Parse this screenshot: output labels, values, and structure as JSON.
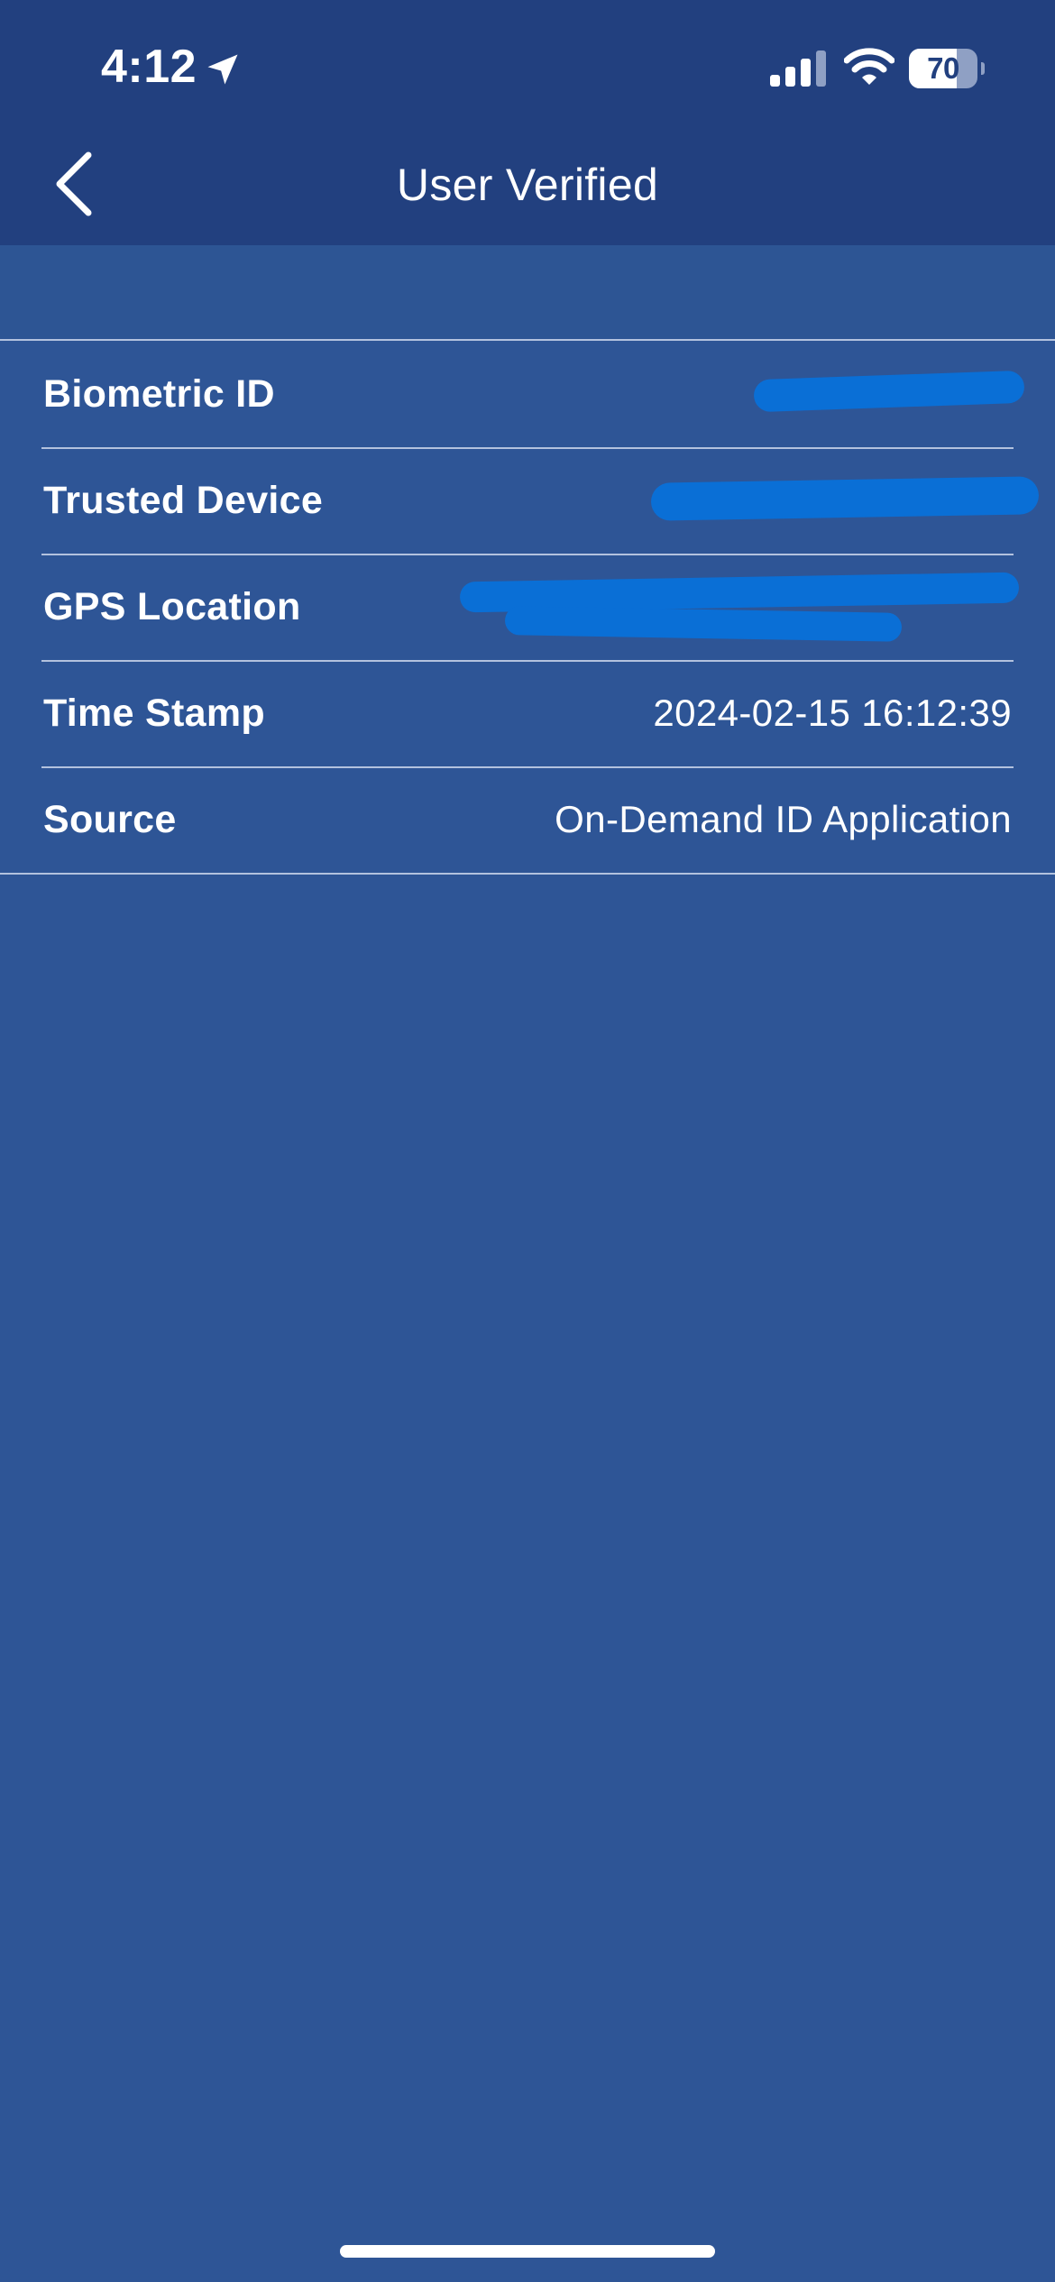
{
  "status_bar": {
    "time": "4:12",
    "battery_percent": "70",
    "battery_level": 0.7,
    "icons": [
      "location-arrow-icon",
      "cellular-signal-icon",
      "wifi-icon",
      "battery-icon"
    ]
  },
  "header": {
    "back_icon": "chevron-left-icon",
    "title": "User Verified"
  },
  "details": [
    {
      "label": "Biometric ID",
      "value": "",
      "redacted": true
    },
    {
      "label": "Trusted Device",
      "value": "",
      "redacted": true
    },
    {
      "label": "GPS Location",
      "value": "",
      "redacted": true
    },
    {
      "label": "Time Stamp",
      "value": "2024-02-15 16:12:39",
      "redacted": false
    },
    {
      "label": "Source",
      "value": "On-Demand ID Application",
      "redacted": false
    }
  ],
  "colors": {
    "header_bg": "#22407f",
    "page_bg": "#2e5596",
    "divider": "#b3c2de",
    "redaction": "#0a6fd6",
    "text": "#ffffff"
  }
}
